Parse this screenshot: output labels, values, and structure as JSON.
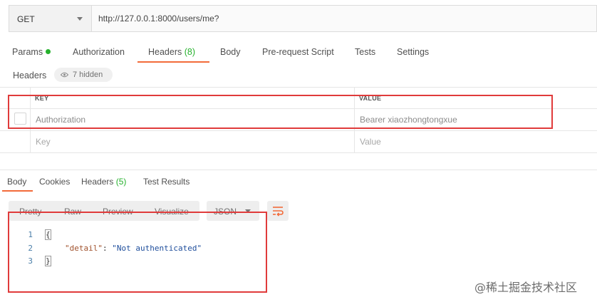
{
  "request": {
    "method": "GET",
    "url": "http://127.0.0.1:8000/users/me?"
  },
  "request_tabs": [
    {
      "label": "Params",
      "count": "",
      "dot": true
    },
    {
      "label": "Authorization",
      "count": ""
    },
    {
      "label": "Headers",
      "count": "(8)",
      "active": true
    },
    {
      "label": "Body",
      "count": ""
    },
    {
      "label": "Pre-request Script",
      "count": ""
    },
    {
      "label": "Tests",
      "count": ""
    },
    {
      "label": "Settings",
      "count": ""
    }
  ],
  "headers_section": {
    "title": "Headers",
    "hidden_label": "7 hidden"
  },
  "headers_table": {
    "columns": [
      "KEY",
      "VALUE"
    ],
    "rows": [
      {
        "key": "Authorization",
        "value": "Bearer xiaozhongtongxue"
      }
    ],
    "placeholder_key": "Key",
    "placeholder_value": "Value"
  },
  "response_tabs": [
    {
      "label": "Body",
      "count": "",
      "active": true
    },
    {
      "label": "Cookies",
      "count": ""
    },
    {
      "label": "Headers",
      "count": "(5)"
    },
    {
      "label": "Test Results",
      "count": ""
    }
  ],
  "format_toolbar": {
    "buttons": [
      "Pretty",
      "Raw",
      "Preview",
      "Visualize"
    ],
    "language": "JSON"
  },
  "response_body": {
    "line_numbers": [
      "1",
      "2",
      "3"
    ],
    "open_brace": "{",
    "close_brace": "}",
    "key": "\"detail\"",
    "colon": ": ",
    "value": "\"Not authenticated\""
  },
  "watermark": "@稀土掘金技术社区",
  "colors": {
    "accent_underline": "#f26b3a",
    "count_green": "#26b12d",
    "annotation_red": "#e03b3b",
    "json_key": "#a0522d",
    "json_string": "#1f4e9c"
  }
}
